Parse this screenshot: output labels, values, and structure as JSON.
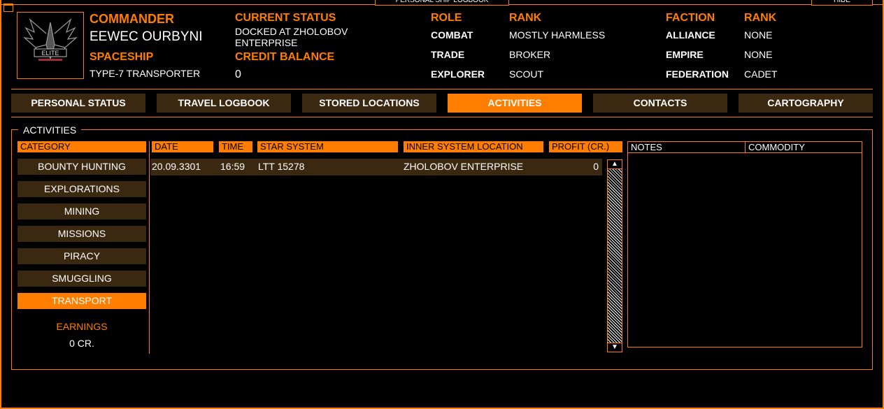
{
  "window": {
    "title": "PERSONAL SHIP LOGBOOK",
    "hide_label": "HIDE"
  },
  "commander": {
    "label": "COMMANDER",
    "name": "EEWEC OURBYNI",
    "spaceship_label": "SPACESHIP",
    "spaceship": "TYPE-7 TRANSPORTER",
    "status_label": "CURRENT STATUS",
    "status_line1": "DOCKED AT ZHOLOBOV",
    "status_line2": "ENTERPRISE",
    "credit_label": "CREDIT BALANCE",
    "credit": "0",
    "emblem_text": "ELITE"
  },
  "roles": {
    "role_header": "ROLE",
    "rank_header": "RANK",
    "items": [
      {
        "role": "COMBAT",
        "rank": "MOSTLY HARMLESS"
      },
      {
        "role": "TRADE",
        "rank": "BROKER"
      },
      {
        "role": "EXPLORER",
        "rank": "SCOUT"
      }
    ]
  },
  "factions": {
    "faction_header": "FACTION",
    "rank_header": "RANK",
    "items": [
      {
        "faction": "ALLIANCE",
        "rank": "NONE"
      },
      {
        "faction": "EMPIRE",
        "rank": "NONE"
      },
      {
        "faction": "FEDERATION",
        "rank": "CADET"
      }
    ]
  },
  "tabs": [
    {
      "label": "PERSONAL STATUS",
      "active": false
    },
    {
      "label": "TRAVEL LOGBOOK",
      "active": false
    },
    {
      "label": "STORED LOCATIONS",
      "active": false
    },
    {
      "label": "ACTIVITIES",
      "active": true
    },
    {
      "label": "CONTACTS",
      "active": false
    },
    {
      "label": "CARTOGRAPHY",
      "active": false
    }
  ],
  "activities": {
    "panel_title": "ACTIVITIES",
    "category_header": "CATEGORY",
    "categories": [
      {
        "label": "BOUNTY HUNTING",
        "active": false
      },
      {
        "label": "EXPLORATIONS",
        "active": false
      },
      {
        "label": "MINING",
        "active": false
      },
      {
        "label": "MISSIONS",
        "active": false
      },
      {
        "label": "PIRACY",
        "active": false
      },
      {
        "label": "SMUGGLING",
        "active": false
      },
      {
        "label": "TRANSPORT",
        "active": true
      }
    ],
    "earnings_label": "EARNINGS",
    "earnings_value": "0 CR.",
    "columns": [
      "DATE",
      "TIME",
      "STAR SYSTEM",
      "INNER SYSTEM LOCATION",
      "PROFIT (CR.)"
    ],
    "rows": [
      {
        "date": "20.09.3301",
        "time": "16:59",
        "star_system": "LTT 15278",
        "location": "ZHOLOBOV ENTERPRISE",
        "profit": "0"
      }
    ],
    "notes_columns": [
      "NOTES",
      "COMMODITY"
    ]
  },
  "colors": {
    "accent": "#ff7e00",
    "tab_bg": "#3a2810",
    "background": "#000000"
  },
  "icons": {
    "scroll_up": "▲",
    "scroll_down": "▼"
  }
}
